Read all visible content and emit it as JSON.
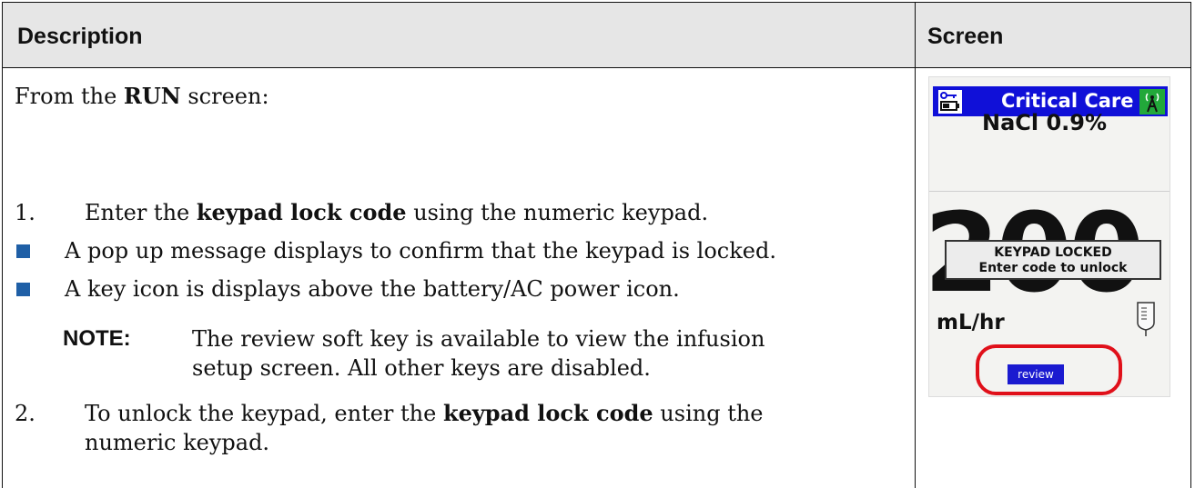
{
  "table": {
    "header_description": "Description",
    "header_screen": "Screen"
  },
  "content": {
    "intro_prefix": "From the ",
    "intro_bold": "RUN",
    "intro_suffix": " screen:",
    "step1_number": "1.",
    "step1_prefix": "Enter the ",
    "step1_bold": "keypad lock code",
    "step1_suffix": " using the numeric keypad.",
    "bullet1": "A pop up message displays to confirm that the keypad is locked.",
    "bullet2": "A key icon is displays above the battery/AC power icon.",
    "note_label": "NOTE:",
    "note_line1": "The review soft key is available to view the infusion",
    "note_line2": "setup screen. All other keys are disabled.",
    "step2_number": "2.",
    "step2_prefix": "To unlock the keypad, enter the ",
    "step2_bold": "keypad lock code",
    "step2_suffix": " using the",
    "step2_line2": "numeric keypad."
  },
  "device": {
    "title": "Critical Care",
    "drug": "NaCl 0.9%",
    "rate_digits": "200",
    "popup_line1": "KEYPAD LOCKED",
    "popup_line2": "Enter code to unlock",
    "unit": "mL/hr",
    "review_label": "review",
    "icons": [
      "key-battery-icon",
      "wireless-icon",
      "iv-bag-icon"
    ],
    "colors": {
      "title_bar": "#1010d8",
      "wireless_badge": "#22a83a",
      "highlight_ring": "#e0101a"
    }
  }
}
